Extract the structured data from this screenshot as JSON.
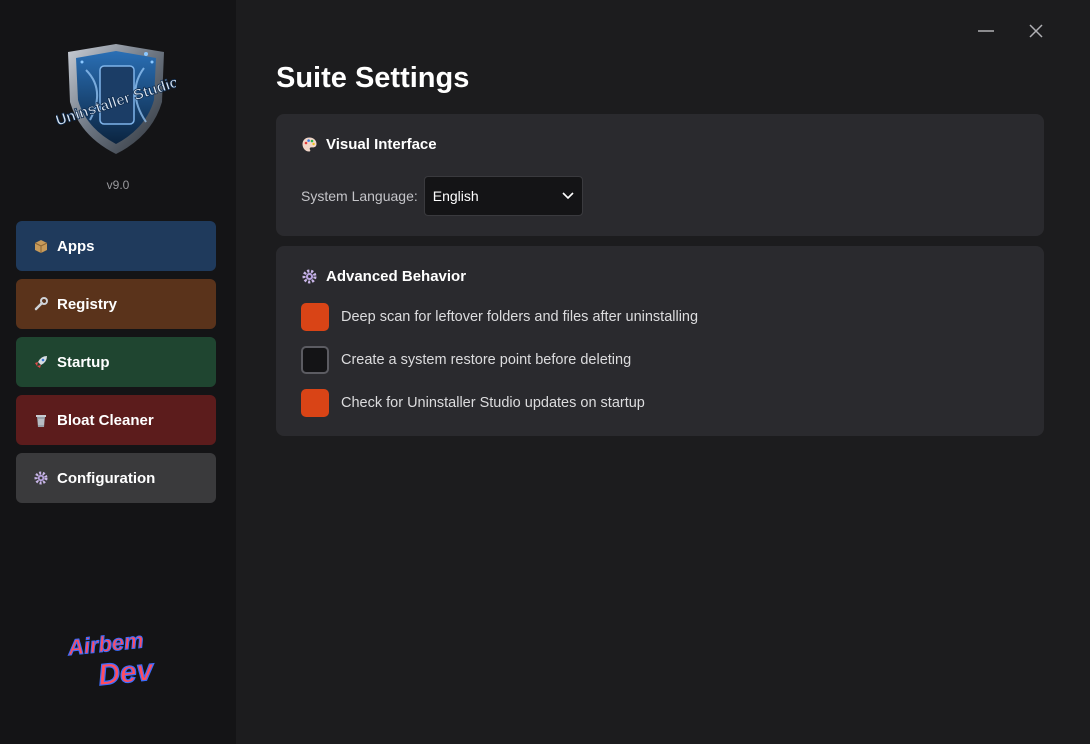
{
  "app": {
    "version": "v9.0",
    "logo_text": "Uninstaller Studio",
    "brand_text": [
      "Airbem",
      "Dev"
    ]
  },
  "sidebar": {
    "items": [
      {
        "label": "Apps",
        "icon": "package-icon",
        "color": "#1f3a5c"
      },
      {
        "label": "Registry",
        "icon": "wrench-icon",
        "color": "#5a331b"
      },
      {
        "label": "Startup",
        "icon": "rocket-icon",
        "color": "#1f4530"
      },
      {
        "label": "Bloat Cleaner",
        "icon": "trash-icon",
        "color": "#5c1c1c"
      },
      {
        "label": "Configuration",
        "icon": "gear-icon",
        "color": "#3a3a3c",
        "active": true
      }
    ]
  },
  "window_controls": {
    "minimize": "minimize-icon",
    "close": "close-icon"
  },
  "main": {
    "title": "Suite Settings",
    "visual_interface": {
      "heading": "Visual Interface",
      "icon": "palette-icon",
      "language_label": "System Language:",
      "language_value": "English"
    },
    "advanced_behavior": {
      "heading": "Advanced Behavior",
      "icon": "gear-icon",
      "options": [
        {
          "label": "Deep scan for leftover folders and files after uninstalling",
          "checked": true
        },
        {
          "label": "Create a system restore point before deleting",
          "checked": false
        },
        {
          "label": "Check for Uninstaller Studio updates on startup",
          "checked": true
        }
      ]
    }
  },
  "colors": {
    "accent": "#d94416",
    "sidebar_bg": "#141416",
    "main_bg": "#1c1c1e",
    "card_bg": "#2a2a2e"
  }
}
